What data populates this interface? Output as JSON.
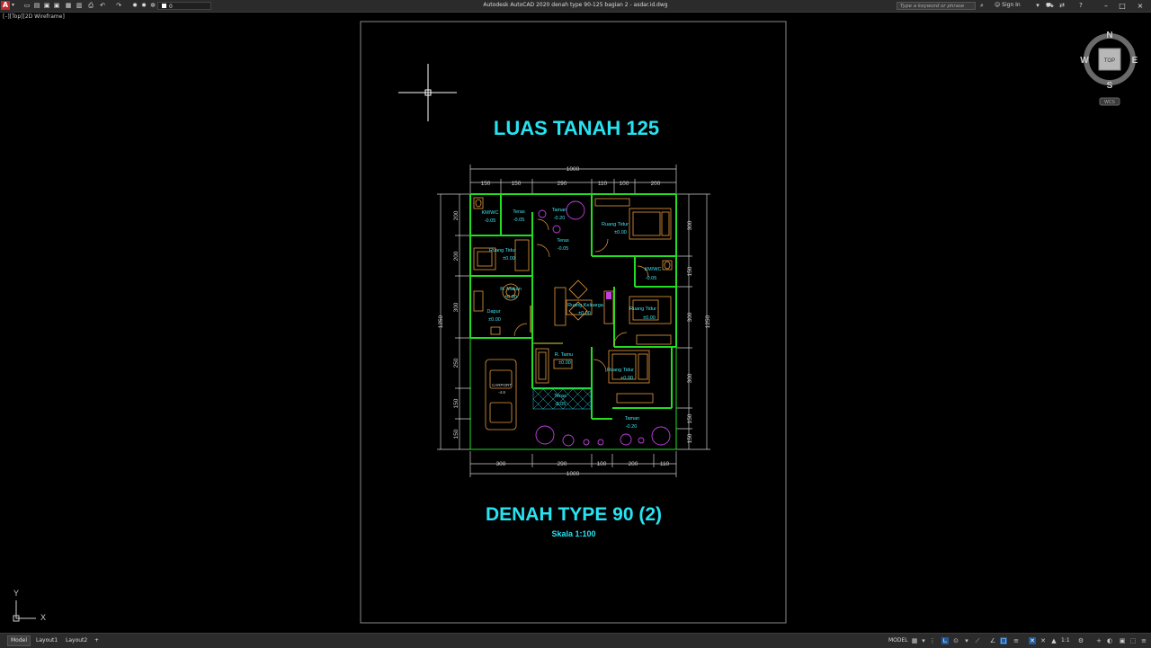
{
  "app": {
    "title": "Autodesk AutoCAD 2020    denah type 90-125 bagian 2 - asdar.id.dwg",
    "logo_letter": "A",
    "layer_current": "0"
  },
  "search": {
    "placeholder": "Type a keyword or phrase"
  },
  "user": {
    "signin": "Sign In"
  },
  "viewport": {
    "label": "[–][Top][2D Wireframe]"
  },
  "viewcube": {
    "north": "N",
    "south": "S",
    "east": "E",
    "west": "W",
    "face": "TOP",
    "wcs": "WCS"
  },
  "ucs": {
    "x": "X",
    "y": "Y"
  },
  "drawing": {
    "title_top": "LUAS TANAH 125",
    "title_bottom": "DENAH TYPE 90 (2)",
    "scale": "Skala  1:100",
    "dims_top": [
      "150",
      "150",
      "290",
      "110",
      "100",
      "200"
    ],
    "dim_top_total": "1000",
    "dims_bottom": [
      "300",
      "290",
      "100",
      "200",
      "110"
    ],
    "dim_bottom_total": "1000",
    "dims_left": [
      "200",
      "200",
      "300",
      "250",
      "150",
      "150"
    ],
    "dims_right": [
      "300",
      "150",
      "300",
      "300",
      "150",
      "150"
    ],
    "dim_left_total": "1250",
    "dim_right_total": "1250",
    "rooms": [
      {
        "name": "KM/WC",
        "level": "-0.05"
      },
      {
        "name": "Teras",
        "level": "-0.05"
      },
      {
        "name": "Taman",
        "level": "-0.20"
      },
      {
        "name": "Ruang Tidur",
        "level": "±0.00"
      },
      {
        "name": "Ruang Tidur",
        "level": "±0.00"
      },
      {
        "name": "Teras",
        "level": "-0.05"
      },
      {
        "name": "KM/WC",
        "level": "-0.05"
      },
      {
        "name": "R. Makan",
        "level": "±0.00"
      },
      {
        "name": "Dapur",
        "level": "±0.00"
      },
      {
        "name": "Ruang Keluarga",
        "level": "±0.00"
      },
      {
        "name": "Ruang Tidur",
        "level": "±0.00"
      },
      {
        "name": "R. Tamu",
        "level": "±0.00"
      },
      {
        "name": "Ruang Tidur",
        "level": "+0.00"
      },
      {
        "name": "Teras",
        "level": "-0.05"
      },
      {
        "name": "Taman",
        "level": "-0.20"
      },
      {
        "name": "CARPORT",
        "level": "-4.8"
      }
    ]
  },
  "status": {
    "tabs": [
      "Model",
      "Layout1",
      "Layout2"
    ],
    "add_tab": "+",
    "model_button": "MODEL",
    "scale": "1:1"
  }
}
